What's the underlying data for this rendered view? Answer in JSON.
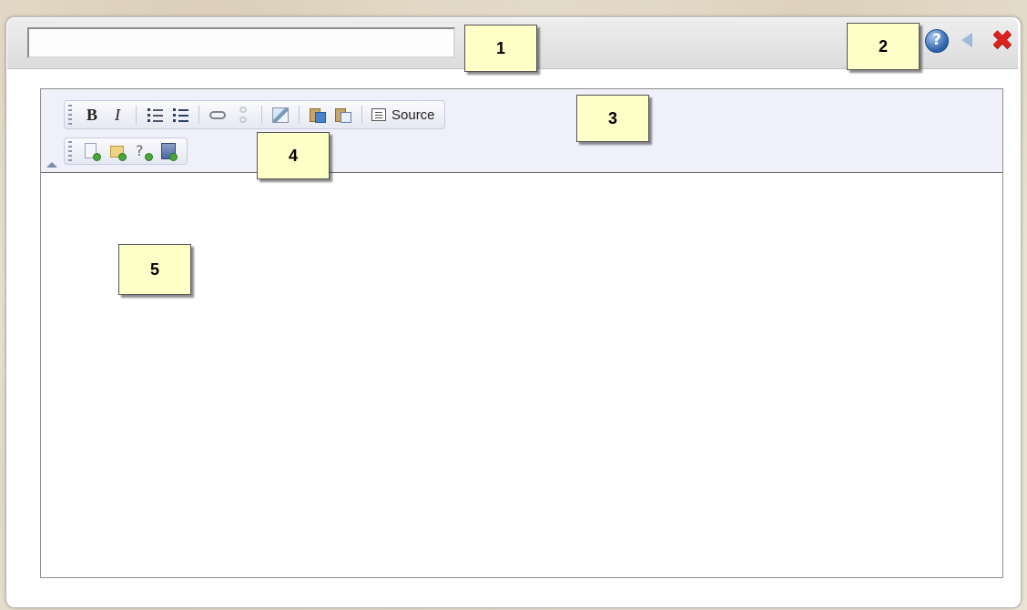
{
  "header": {
    "title_value": "",
    "help_icon": "help-icon",
    "back_icon": "back-arrow-icon",
    "close_icon": "close-icon"
  },
  "callouts": [
    "1",
    "2",
    "3",
    "4",
    "5"
  ],
  "toolbar": {
    "bold_label": "B",
    "italic_label": "I",
    "source_label": "Source",
    "row1_icons": [
      "bold-icon",
      "italic-icon",
      "numbered-list-icon",
      "bulleted-list-icon",
      "link-icon",
      "unlink-icon",
      "image-icon",
      "paste-icon",
      "paste-from-word-icon",
      "source-icon"
    ],
    "row2_icons": [
      "insert-page-icon",
      "insert-folder-icon",
      "insert-question-icon",
      "insert-form-icon"
    ]
  },
  "editor": {
    "content": ""
  },
  "colors": {
    "callout_bg": "#ffffc8",
    "toolbar_bg": "#eff0f9",
    "close_red": "#d8241c",
    "help_blue": "#2a5ea8"
  }
}
